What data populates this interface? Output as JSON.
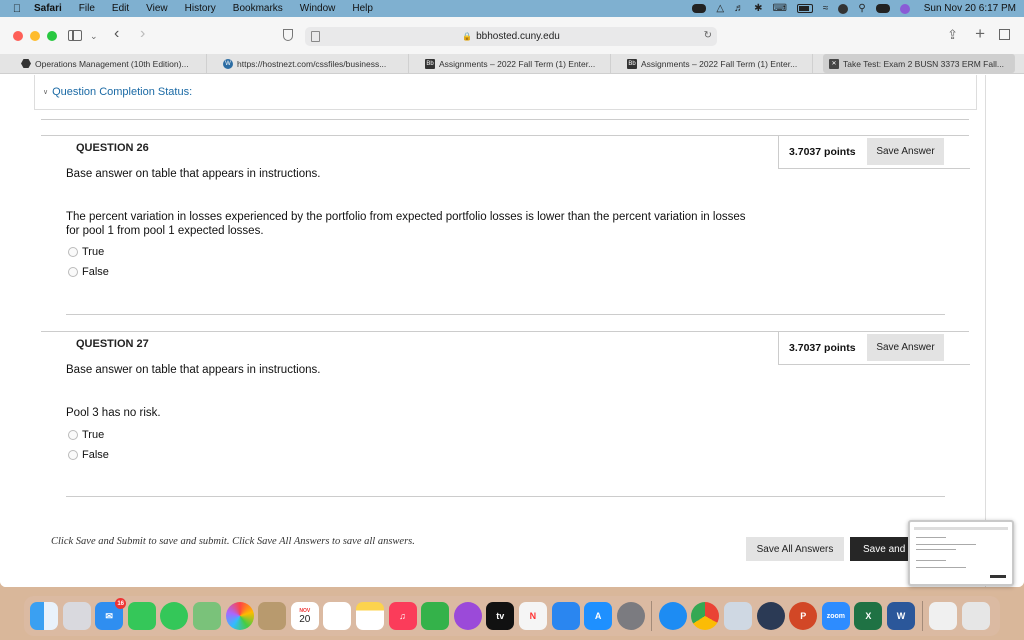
{
  "menubar": {
    "app": "Safari",
    "items": [
      "File",
      "Edit",
      "View",
      "History",
      "Bookmarks",
      "Window",
      "Help"
    ],
    "clock": "Sun Nov 20  6:17 PM"
  },
  "browser": {
    "url": "bbhosted.cuny.edu",
    "tabs": [
      {
        "label": "Operations Management (10th Edition)...",
        "icon": "hexagon-icon"
      },
      {
        "label": "https://hostnezt.com/cssfiles/business...",
        "icon": "wordpress-icon"
      },
      {
        "label": "Assignments – 2022 Fall Term (1) Enter...",
        "icon": "blackboard-icon"
      },
      {
        "label": "Assignments – 2022 Fall Term (1) Enter...",
        "icon": "blackboard-icon"
      },
      {
        "label": "Take Test: Exam 2 BUSN 3373 ERM Fall...",
        "icon": "close-icon",
        "active": true
      }
    ]
  },
  "page": {
    "completion_status": "Question Completion Status:",
    "questions": [
      {
        "heading": "QUESTION 26",
        "points": "3.7037 points",
        "save_label": "Save Answer",
        "instruction": "Base answer on table that appears in instructions.",
        "prompt": "The percent variation in losses experienced by the portfolio from expected portfolio losses is lower than the percent variation in losses for pool 1 from pool 1 expected losses.",
        "options": [
          "True",
          "False"
        ]
      },
      {
        "heading": "QUESTION 27",
        "points": "3.7037 points",
        "save_label": "Save Answer",
        "instruction": "Base answer on table that appears in instructions.",
        "prompt": "Pool 3 has no risk.",
        "options": [
          "True",
          "False"
        ]
      }
    ],
    "footer_note": "Click Save and Submit to save and submit. Click Save All Answers to save all answers.",
    "save_all_label": "Save All Answers",
    "save_submit_label": "Save and S"
  },
  "dock": {
    "calendar_month": "NOV",
    "calendar_day": "20",
    "mail_badge": "16",
    "apps": [
      "Finder",
      "Launchpad",
      "Mail",
      "FaceTime",
      "Messages",
      "Maps",
      "Photos",
      "Contacts",
      "Calendar",
      "Reminders",
      "Notes",
      "Music",
      "Numbers",
      "Podcasts",
      "TV",
      "News",
      "Keynote",
      "App Store",
      "System Preferences",
      "Safari",
      "Chrome",
      "Preview",
      "QuickTime",
      "PowerPoint",
      "Zoom",
      "Excel",
      "Word",
      "Recent",
      "Trash"
    ],
    "zoom_label": "zoom",
    "tv_label": "tv"
  }
}
